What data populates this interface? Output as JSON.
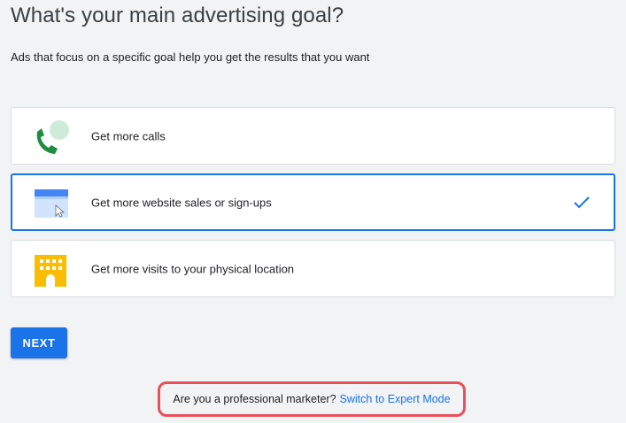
{
  "header": {
    "title": "What's your main advertising goal?",
    "subtitle": "Ads that focus on a specific goal help you get the results that you want"
  },
  "goals": [
    {
      "label": "Get more calls",
      "icon": "phone-chat-icon",
      "selected": false
    },
    {
      "label": "Get more website sales or sign-ups",
      "icon": "browser-cursor-icon",
      "selected": true
    },
    {
      "label": "Get more visits to your physical location",
      "icon": "building-icon",
      "selected": false
    }
  ],
  "actions": {
    "next_label": "NEXT"
  },
  "expert": {
    "question": "Are you a professional marketer?",
    "link": "Switch to Expert Mode"
  },
  "colors": {
    "accent": "#1a73e8",
    "background": "#f1f3f4",
    "highlight_border": "#e8505b"
  }
}
